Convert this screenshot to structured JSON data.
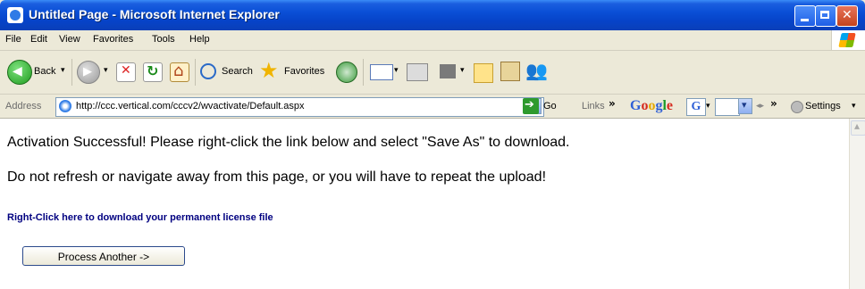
{
  "window": {
    "title": "Untitled Page - Microsoft Internet Explorer"
  },
  "menu": [
    "File",
    "Edit",
    "View",
    "Favorites",
    "Tools",
    "Help"
  ],
  "toolbar": {
    "back_label": "Back",
    "search_label": "Search",
    "favorites_label": "Favorites"
  },
  "address": {
    "label": "Address",
    "url": "http://ccc.vertical.com/cccv2/wvactivate/Default.aspx",
    "go_label": "Go",
    "links_label": "Links",
    "chevron": "»"
  },
  "google": {
    "logo_letters": [
      "G",
      "o",
      "o",
      "g",
      "l",
      "e"
    ],
    "g_button": "G",
    "settings_label": "Settings"
  },
  "content": {
    "message1": "Activation Successful!  Please right-click the link below and select \"Save As\" to download.",
    "message2": "Do not refresh or navigate away from this page, or you will have to repeat the upload!",
    "download_link": "Right-Click here to download your permanent license file",
    "process_button": "Process Another ->"
  },
  "colors": {
    "titlebar": "#0a4fd6",
    "link": "#000080",
    "chrome": "#ece9d8"
  },
  "icons": [
    "back-icon",
    "forward-icon",
    "stop-icon",
    "refresh-icon",
    "home-icon",
    "search-icon",
    "favorites-star-icon",
    "history-icon",
    "mail-icon",
    "print-icon",
    "edit-icon",
    "notes-icon",
    "research-icon",
    "messenger-icon",
    "page-icon",
    "go-icon",
    "settings-icon",
    "windows-logo-icon"
  ]
}
